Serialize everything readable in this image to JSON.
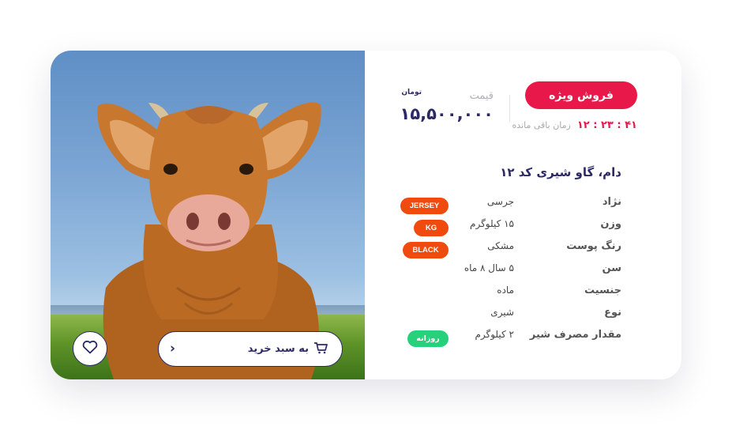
{
  "product": {
    "title": "دام، گاو شیری کد ۱۲",
    "sale_label": "فروش ویژه",
    "timer": {
      "value": "۴۱ : ۲۳ : ۱۲",
      "label": "زمان باقی مانده"
    },
    "price": {
      "label": "قیمت",
      "value": "۱۵,۵۰۰,۰۰۰",
      "currency": "تومان"
    },
    "attributes": [
      {
        "key": "نژاد",
        "value": "جرسی",
        "badge": "JERSEY",
        "badge_color": "#f04a0e"
      },
      {
        "key": "وزن",
        "value": "۱۵ کیلوگرم",
        "badge": "KG",
        "badge_color": "#f04a0e"
      },
      {
        "key": "رنگ پوست",
        "value": "مشکی",
        "badge": "BLACK",
        "badge_color": "#f04a0e"
      },
      {
        "key": "سن",
        "value": "۵ سال ۸ ماه"
      },
      {
        "key": "جنسیت",
        "value": "ماده"
      },
      {
        "key": "نوع",
        "value": "شیری"
      },
      {
        "key": "مقدار مصرف شیر",
        "value": "۲ کیلوگرم",
        "badge": "روزانه",
        "badge_color": "#27d07a"
      }
    ]
  },
  "actions": {
    "add_to_cart_label": "به سبد خرید",
    "cart_icon": "cart-icon",
    "favorite_icon": "heart-icon"
  },
  "colors": {
    "accent": "#e8194a",
    "brand": "#2b2a66",
    "badge_orange": "#f04a0e",
    "badge_green": "#27d07a"
  }
}
